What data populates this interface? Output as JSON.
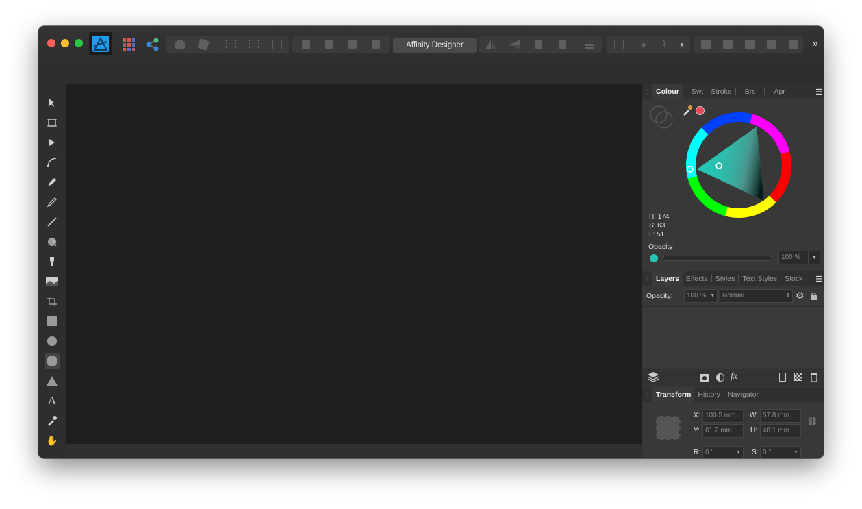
{
  "app": {
    "persona": "Affinity Designer"
  },
  "colour_panel": {
    "tabs": [
      "Colour",
      "Swt",
      "Stroke",
      "Brs",
      "Apr"
    ],
    "hsl": {
      "h": "H: 174",
      "s": "S: 63",
      "l": "L: 51"
    },
    "opacity_label": "Opacity",
    "opacity_value": "100 %",
    "fill_color": "#26c6b4",
    "stroke_color": "#e8475a"
  },
  "layers_panel": {
    "tabs": [
      "Layers",
      "Effects",
      "Styles",
      "Text Styles",
      "Stock"
    ],
    "opacity_label": "Opacity:",
    "opacity_value": "100 %",
    "blend_mode": "Normal"
  },
  "transform_panel": {
    "tabs": [
      "Transform",
      "History",
      "Navigator"
    ],
    "x_label": "X:",
    "x_value": "100.5 mm",
    "y_label": "Y:",
    "y_value": "61.2 mm",
    "w_label": "W:",
    "w_value": "57.8 mm",
    "h_label": "H:",
    "h_value": "48.1 mm",
    "r_label": "R:",
    "r_value": "0 °",
    "s_label": "S:",
    "s_value": "0 °"
  },
  "tools": [
    "move-tool",
    "artboard-tool",
    "node-tool",
    "corner-tool",
    "pen-tool",
    "pencil-tool",
    "vector-brush-tool",
    "fill-tool",
    "transparency-tool",
    "place-image-tool",
    "crop-tool",
    "rectangle-tool",
    "ellipse-tool",
    "rounded-rectangle-tool",
    "triangle-tool",
    "artistic-text-tool",
    "colour-picker-tool",
    "view-tool"
  ],
  "toolbar_icons": [
    "personas-icon",
    "share-icon",
    "boolean-add-icon",
    "boolean-subtract-icon",
    "snapping-icon",
    "align-icon",
    "order-icon",
    "flip-icon",
    "geometry-icon"
  ]
}
